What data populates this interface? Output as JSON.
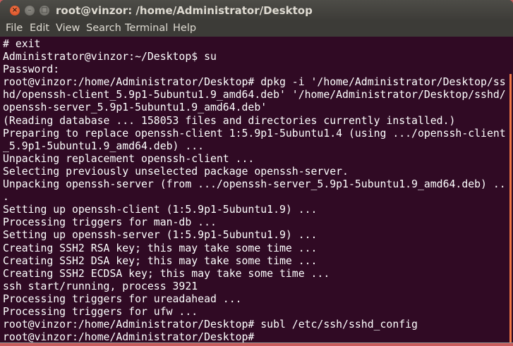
{
  "window": {
    "title": "root@vinzor: /home/Administrator/Desktop",
    "controls": {
      "close": "×",
      "minimize": "–",
      "maximize": "□"
    }
  },
  "menubar": {
    "items": [
      "File",
      "Edit",
      "View",
      "Search",
      "Terminal",
      "Help"
    ]
  },
  "terminal": {
    "background": "#300a24",
    "foreground": "#ffffff",
    "lines": [
      "# exit",
      "Administrator@vinzor:~/Desktop$ su",
      "Password:",
      "root@vinzor:/home/Administrator/Desktop# dpkg -i '/home/Administrator/Desktop/ss",
      "hd/openssh-client_5.9p1-5ubuntu1.9_amd64.deb' '/home/Administrator/Desktop/sshd/",
      "openssh-server_5.9p1-5ubuntu1.9_amd64.deb'",
      "(Reading database ... 158053 files and directories currently installed.)",
      "Preparing to replace openssh-client 1:5.9p1-5ubuntu1.4 (using .../openssh-client",
      "_5.9p1-5ubuntu1.9_amd64.deb) ...",
      "Unpacking replacement openssh-client ...",
      "Selecting previously unselected package openssh-server.",
      "Unpacking openssh-server (from .../openssh-server_5.9p1-5ubuntu1.9_amd64.deb) ..",
      ".",
      "Setting up openssh-client (1:5.9p1-5ubuntu1.9) ...",
      "Processing triggers for man-db ...",
      "Setting up openssh-server (1:5.9p1-5ubuntu1.9) ...",
      "Creating SSH2 RSA key; this may take some time ...",
      "Creating SSH2 DSA key; this may take some time ...",
      "Creating SSH2 ECDSA key; this may take some time ...",
      "ssh start/running, process 3921",
      "Processing triggers for ureadahead ...",
      "Processing triggers for ufw ...",
      "root@vinzor:/home/Administrator/Desktop# subl /etc/ssh/sshd_config",
      "root@vinzor:/home/Administrator/Desktop#"
    ]
  },
  "colors": {
    "accent": "#f07746",
    "titlebar": "#3c3b37"
  }
}
